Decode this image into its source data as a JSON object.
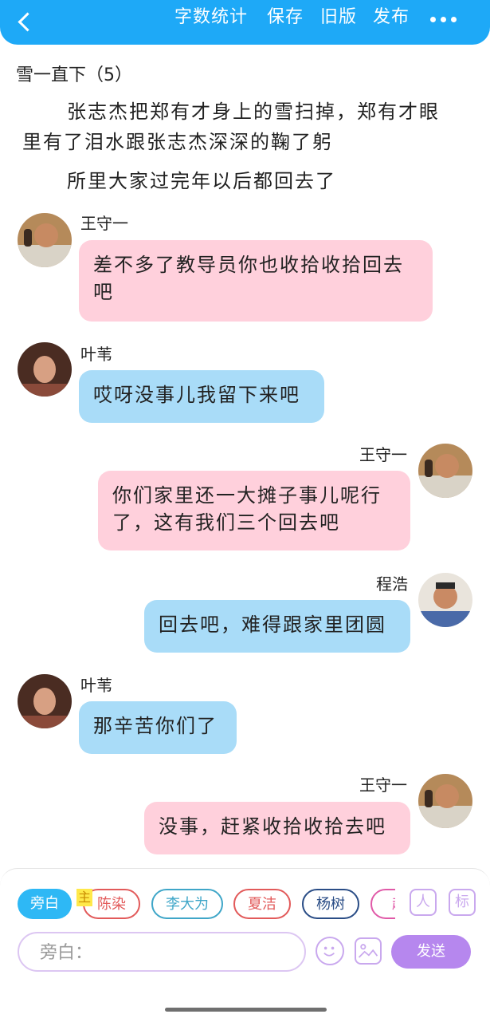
{
  "header": {
    "buttons": [
      "字数统计",
      "保存",
      "旧版",
      "发布"
    ],
    "colors": {
      "header_bg": "#1ea9f7"
    }
  },
  "chapter": {
    "title": "雪一直下（5）"
  },
  "narration": [
    "张志杰把郑有才身上的雪扫掉，郑有才眼",
    "里有了泪水跟张志杰深深的鞠了躬",
    "所里大家过完年以后都回去了"
  ],
  "messages": [
    {
      "speaker": "王守一",
      "side": "left",
      "color": "pink",
      "text": "差不多了教导员你也收拾收拾回去吧"
    },
    {
      "speaker": "叶苇",
      "side": "left",
      "color": "blue",
      "text": "哎呀没事儿我留下来吧"
    },
    {
      "speaker": "王守一",
      "side": "right",
      "color": "pink",
      "text": "你们家里还一大摊子事儿呢行了，这有我们三个回去吧"
    },
    {
      "speaker": "程浩",
      "side": "right",
      "color": "blue",
      "text": "回去吧，难得跟家里团圆"
    },
    {
      "speaker": "叶苇",
      "side": "left",
      "color": "blue",
      "text": "那辛苦你们了"
    },
    {
      "speaker": "王守一",
      "side": "right",
      "color": "pink",
      "text": "没事，赶紧收拾收拾去吧"
    }
  ],
  "roles": {
    "chips": [
      {
        "label": "旁白",
        "color": "#2eb8f5",
        "selected": true
      },
      {
        "label": "陈染",
        "color": "#e25a5a"
      },
      {
        "label": "李大为",
        "color": "#3fa6c8"
      },
      {
        "label": "夏洁",
        "color": "#e25a5a"
      },
      {
        "label": "杨树",
        "color": "#2a4d86"
      },
      {
        "label": "赵",
        "color": "#e05aa8"
      }
    ],
    "main_badge": "主",
    "side_buttons": [
      "人",
      "标"
    ]
  },
  "composer": {
    "placeholder": "旁白：",
    "send_label": "发送"
  }
}
